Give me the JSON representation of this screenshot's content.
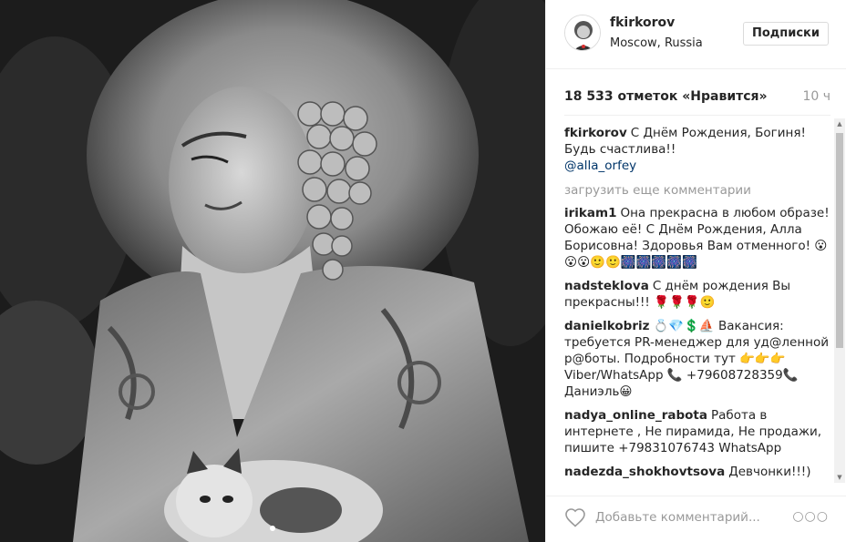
{
  "post": {
    "username": "fkirkorov",
    "location": "Moscow, Russia",
    "follow_label": "Подписки",
    "likes": "18 533 отметок «Нравится»",
    "time": "10 ч"
  },
  "caption": {
    "user": "fkirkorov",
    "text": "С Днём Рождения, Богиня! Будь счастлива!!",
    "mention": "@alla_orfey"
  },
  "load_more_label": "загрузить еще комментарии",
  "comments": [
    {
      "user": "irikam1",
      "text": "Она прекрасна в любом образе! Обожаю её! С Днём Рождения, Алла Борисовна! Здоровья Вам отменного! 😮😮😮🙂🙂🎆🎆🎆🎆🎆"
    },
    {
      "user": "nadsteklova",
      "text": "С днём рождения Вы прекрасны!!! 🌹🌹🌹🙂"
    },
    {
      "user": "danielkobriz",
      "text": "💍💎💲⛵ Вакансия: требуется PR-менеджер для уд@ленной р@боты. Подробности тут 👉👉👉 Viber/WhatsApp 📞 +79608728359📞 Даниэль😀"
    },
    {
      "user": "nadya_online_rabota",
      "text": "Работа в интернете , Не пирамида, Не продажи, пишите +79831076743 WhatsApp"
    },
    {
      "user": "nadezda_shokhovtsova",
      "text": "Девчонки!!!)"
    }
  ],
  "footer": {
    "comment_placeholder": "Добавьте комментарий...",
    "more_label": "○○○"
  },
  "icons": {
    "heart": "heart-icon",
    "more": "more-options-icon",
    "avatar": "avatar"
  }
}
